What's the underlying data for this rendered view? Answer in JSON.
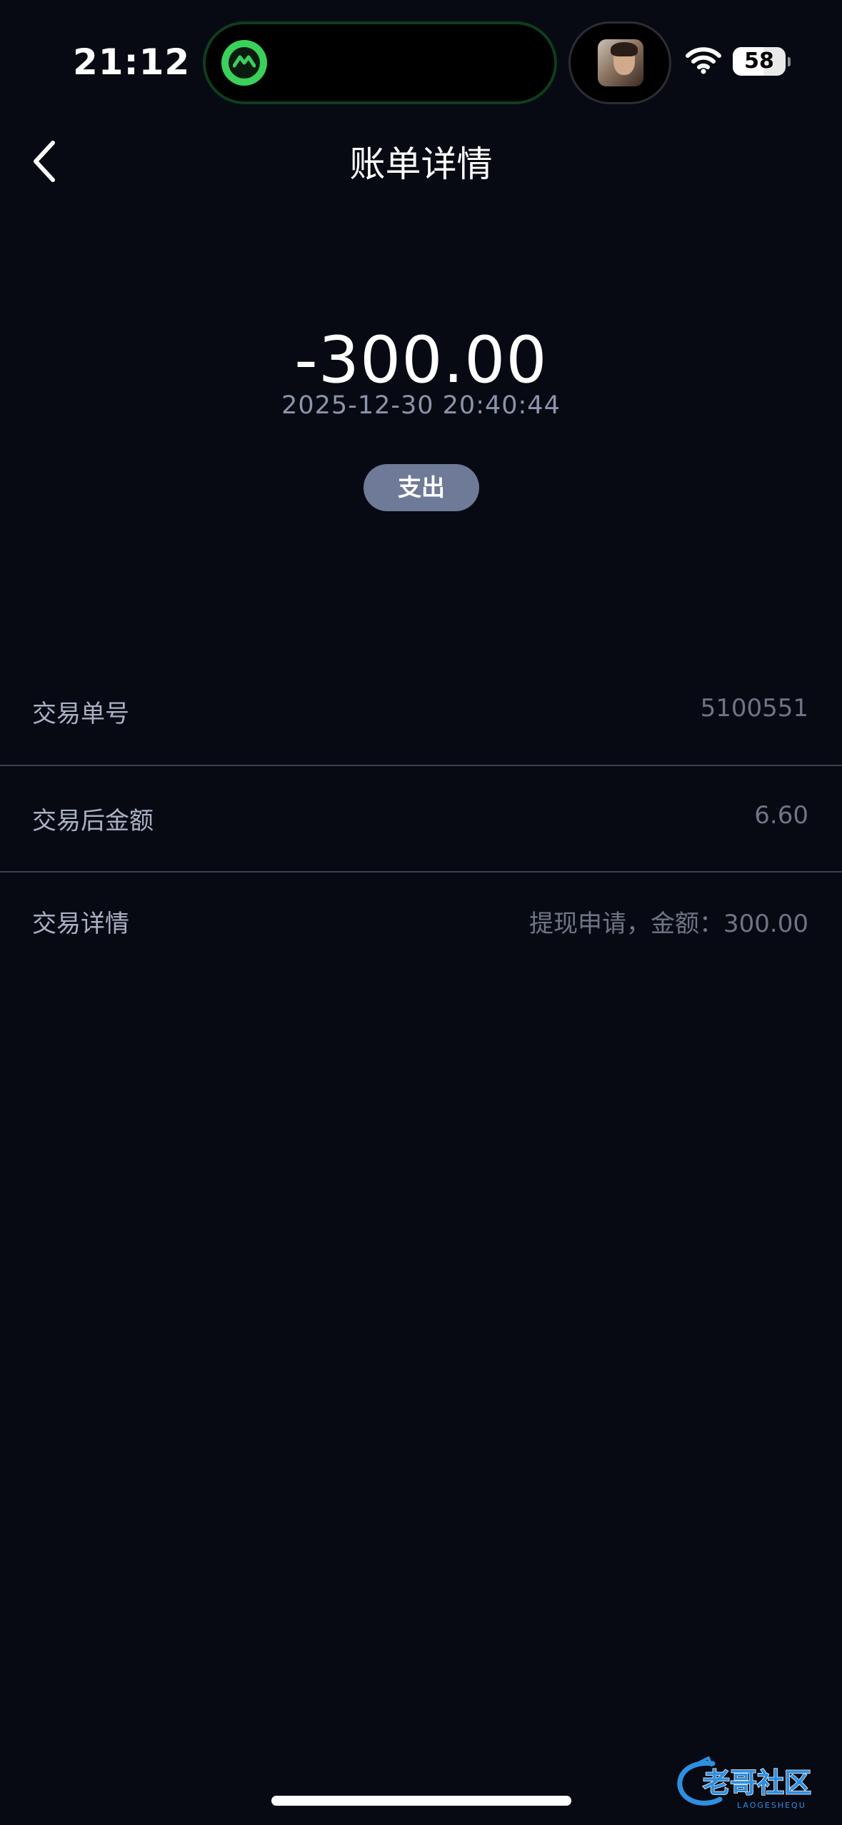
{
  "status_bar": {
    "time": "21:12",
    "battery_level": "58",
    "battery_fraction": 0.58
  },
  "nav": {
    "title": "账单详情"
  },
  "transaction": {
    "amount": "-300.00",
    "datetime": "2025-12-30 20:40:44",
    "type": "支出"
  },
  "details": {
    "rows": [
      {
        "label": "交易单号",
        "value": "5100551"
      },
      {
        "label": "交易后金额",
        "value": "6.60"
      },
      {
        "label": "交易详情",
        "value": "提现申请，金额：300.00"
      }
    ]
  },
  "watermark": {
    "text": "老哥社区",
    "subtext": "LAOGESHEQU"
  },
  "colors": {
    "background": "#070a13",
    "badge": "#6f7a98",
    "label": "#aab1c4",
    "value": "#6f7585",
    "divider": "#3c404b"
  }
}
